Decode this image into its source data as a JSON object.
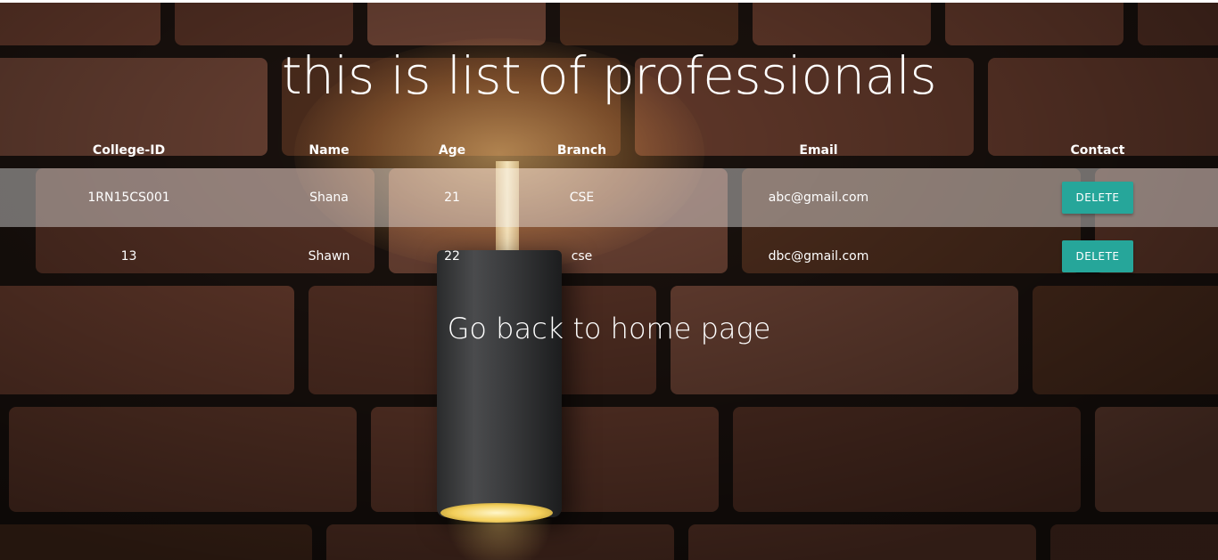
{
  "page": {
    "title": "this is list of professionals",
    "home_link": "Go back to home page"
  },
  "table": {
    "headers": [
      "College-ID",
      "Name",
      "Age",
      "Branch",
      "Email",
      "Contact"
    ],
    "rows": [
      {
        "college_id": "1RN15CS001",
        "name": "Shana",
        "age": "21",
        "branch": "CSE",
        "email": "abc@gmail.com",
        "action": "DELETE"
      },
      {
        "college_id": "13",
        "name": "Shawn",
        "age": "22",
        "branch": "cse",
        "email": "dbc@gmail.com",
        "action": "DELETE"
      }
    ]
  },
  "colors": {
    "button": "#26a69a",
    "text": "#ffffff",
    "brick": "#5a3527",
    "mortar": "#1e1410"
  },
  "icons": {
    "background": "brick-wall-with-lamp-photo"
  }
}
